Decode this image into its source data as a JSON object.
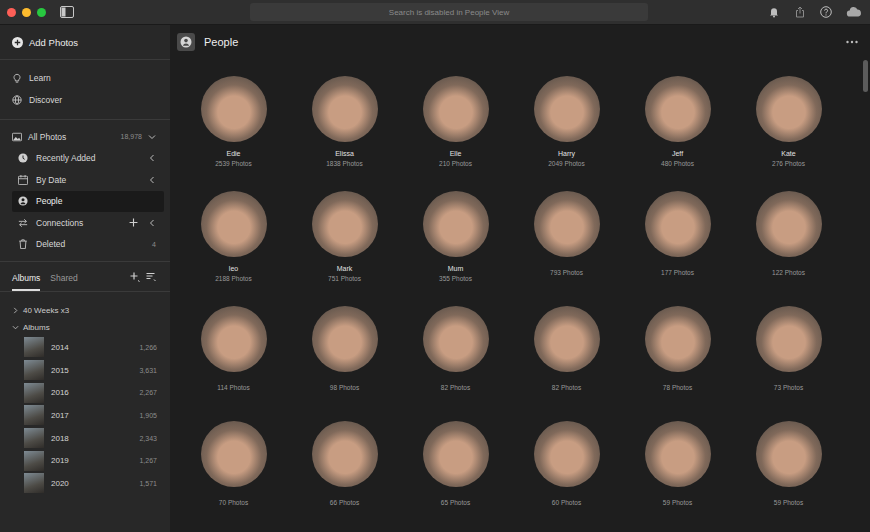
{
  "search": {
    "placeholder": "Search is disabled in People View",
    "disabled": true
  },
  "sidebar": {
    "add_photos": "Add Photos",
    "links": [
      {
        "label": "Learn"
      },
      {
        "label": "Discover"
      }
    ],
    "all_photos": {
      "label": "All Photos",
      "count": "18,978",
      "expanded": true
    },
    "library": [
      {
        "label": "Recently Added",
        "count": "",
        "expandable": true,
        "expanded": false,
        "addable": false,
        "selected": false
      },
      {
        "label": "By Date",
        "count": "",
        "expandable": true,
        "expanded": false,
        "addable": false,
        "selected": false
      },
      {
        "label": "People",
        "count": "",
        "expandable": false,
        "expanded": false,
        "addable": false,
        "selected": true
      },
      {
        "label": "Connections",
        "count": "",
        "expandable": true,
        "expanded": false,
        "addable": true,
        "selected": false
      },
      {
        "label": "Deleted",
        "count": "4",
        "expandable": false,
        "expanded": false,
        "addable": false,
        "selected": false
      }
    ],
    "tabs": [
      {
        "label": "Albums",
        "selected": true
      },
      {
        "label": "Shared",
        "selected": false
      }
    ],
    "tree": [
      {
        "label": "40 Weeks x3",
        "expanded": false,
        "children": []
      },
      {
        "label": "Albums",
        "expanded": true,
        "children": [
          {
            "name": "2014",
            "count": "1,266"
          },
          {
            "name": "2015",
            "count": "3,631"
          },
          {
            "name": "2016",
            "count": "2,267"
          },
          {
            "name": "2017",
            "count": "1,905"
          },
          {
            "name": "2018",
            "count": "2,343"
          },
          {
            "name": "2019",
            "count": "1,267"
          },
          {
            "name": "2020",
            "count": "1,571"
          }
        ]
      }
    ]
  },
  "page": {
    "title": "People"
  },
  "people": [
    {
      "name": "Edie",
      "count": "2539 Photos"
    },
    {
      "name": "Elissa",
      "count": "1838 Photos"
    },
    {
      "name": "Elle",
      "count": "210 Photos"
    },
    {
      "name": "Harry",
      "count": "2049 Photos"
    },
    {
      "name": "Jeff",
      "count": "480 Photos"
    },
    {
      "name": "Kate",
      "count": "276 Photos"
    },
    {
      "name": "leo",
      "count": "2188 Photos"
    },
    {
      "name": "Mark",
      "count": "751 Photos"
    },
    {
      "name": "Mum",
      "count": "355 Photos"
    },
    {
      "count": "793 Photos"
    },
    {
      "count": "177 Photos"
    },
    {
      "count": "122 Photos"
    },
    {
      "count": "114 Photos"
    },
    {
      "count": "98 Photos"
    },
    {
      "count": "82 Photos"
    },
    {
      "count": "82 Photos"
    },
    {
      "count": "78 Photos"
    },
    {
      "count": "73 Photos"
    },
    {
      "count": "70 Photos"
    },
    {
      "count": "66 Photos"
    },
    {
      "count": "65 Photos"
    },
    {
      "count": "60 Photos"
    },
    {
      "count": "59 Photos"
    },
    {
      "count": "59 Photos"
    }
  ]
}
